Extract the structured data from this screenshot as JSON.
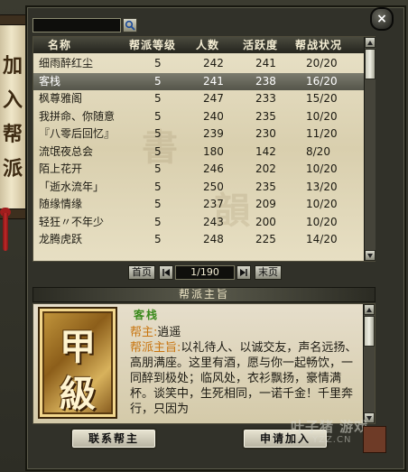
{
  "banner": {
    "text": "加入帮派"
  },
  "search": {
    "placeholder": ""
  },
  "columns": [
    "名称",
    "帮派等级",
    "人数",
    "活跃度",
    "帮战状况"
  ],
  "rows": [
    {
      "name": "细雨醉红尘",
      "level": "5",
      "members": "242",
      "activity": "241",
      "war": "20/20"
    },
    {
      "name": "客栈",
      "level": "5",
      "members": "241",
      "activity": "238",
      "war": "16/20"
    },
    {
      "name": "枫尊雅阁",
      "level": "5",
      "members": "247",
      "activity": "233",
      "war": "15/20"
    },
    {
      "name": "我拼命、你随意",
      "level": "5",
      "members": "240",
      "activity": "235",
      "war": "10/20"
    },
    {
      "name": "『八零后回忆』",
      "level": "5",
      "members": "239",
      "activity": "230",
      "war": "11/20"
    },
    {
      "name": "流氓夜总会",
      "level": "5",
      "members": "180",
      "activity": "142",
      "war": "8/20"
    },
    {
      "name": "陌上花开",
      "level": "5",
      "members": "246",
      "activity": "202",
      "war": "10/20"
    },
    {
      "name": "「逝水流年」",
      "level": "5",
      "members": "250",
      "activity": "235",
      "war": "13/20"
    },
    {
      "name": "随缘情缘",
      "level": "5",
      "members": "237",
      "activity": "209",
      "war": "10/20"
    },
    {
      "name": "轻狂〃不年少",
      "level": "5",
      "members": "243",
      "activity": "200",
      "war": "10/20"
    },
    {
      "name": "龙腾虎跃",
      "level": "5",
      "members": "248",
      "activity": "225",
      "war": "14/20"
    }
  ],
  "selected_row": 1,
  "pager": {
    "first": "首页",
    "last": "末页",
    "page": "1/190"
  },
  "section_title": "帮派主旨",
  "badge": {
    "line1": "甲",
    "line2": "級"
  },
  "detail": {
    "guild_name": "客栈",
    "leader_label": "帮主:",
    "leader": "逍遥",
    "purpose_label": "帮派主旨:",
    "purpose": "以礼待人、以诚交友，声名远扬、高朋满座。这里有酒，愿与你一起畅饮，一同醉到极处；临风处，衣衫飘扬，豪情满杯。谈笑中，生死相同，一诺千金！千里奔行，只因为"
  },
  "buttons": {
    "contact": "联系帮主",
    "apply": "申请加入"
  },
  "watermark": {
    "line1": "叶子猪 游戏",
    "line2": "YZZ.CN"
  },
  "close_label": "×"
}
